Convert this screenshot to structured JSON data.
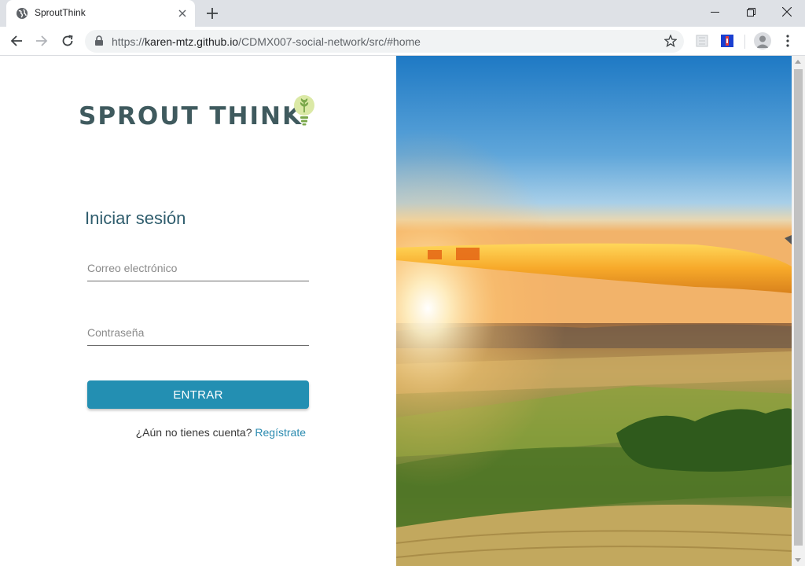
{
  "browser": {
    "tab_title": "SproutThink",
    "url_scheme": "https://",
    "url_host": "karen-mtz.github.io",
    "url_path": "/CDMX007-social-network/src/#home"
  },
  "logo": {
    "text": "SPROUT THINK",
    "colors": {
      "text": "#3f5a5e",
      "bulb": "#dbe9a6",
      "leaf": "#7aa84a"
    }
  },
  "login": {
    "title": "Iniciar sesión",
    "email_placeholder": "Correo electrónico",
    "password_placeholder": "Contraseña",
    "submit_label": "ENTRAR",
    "signup_prompt": "¿Aún no tienes cuenta?",
    "signup_link": "Regístrate"
  },
  "colors": {
    "accent": "#238fb2",
    "heading": "#2f5d6d",
    "link": "#2b8bb0"
  },
  "hero_image": {
    "subject": "wind turbine blade over farmland at sunset"
  }
}
